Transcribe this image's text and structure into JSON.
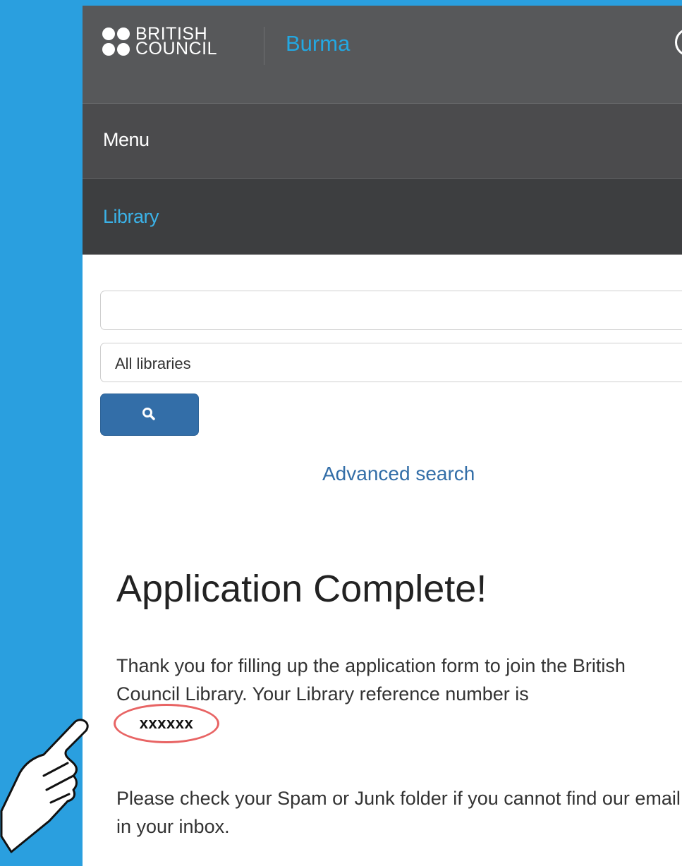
{
  "header": {
    "logo_line1": "BRITISH",
    "logo_line2": "COUNCIL",
    "country": "Burma"
  },
  "menu": {
    "label": "Menu"
  },
  "section": {
    "label": "Library"
  },
  "search": {
    "input_value": "",
    "select_value": "All libraries",
    "button_icon": "search-icon",
    "advanced_link": "Advanced search"
  },
  "content": {
    "heading": "Application Complete!",
    "paragraph1": "Thank you for filling up the application form to join the British Council Library. Your Library reference number is",
    "reference_number": "xxxxxx",
    "paragraph2": "Please check your Spam or Junk folder if you cannot find our email in your inbox."
  },
  "colors": {
    "background": "#2a9fdf",
    "accent": "#23a8e2",
    "button": "#336ea8",
    "highlight": "#e86464"
  }
}
